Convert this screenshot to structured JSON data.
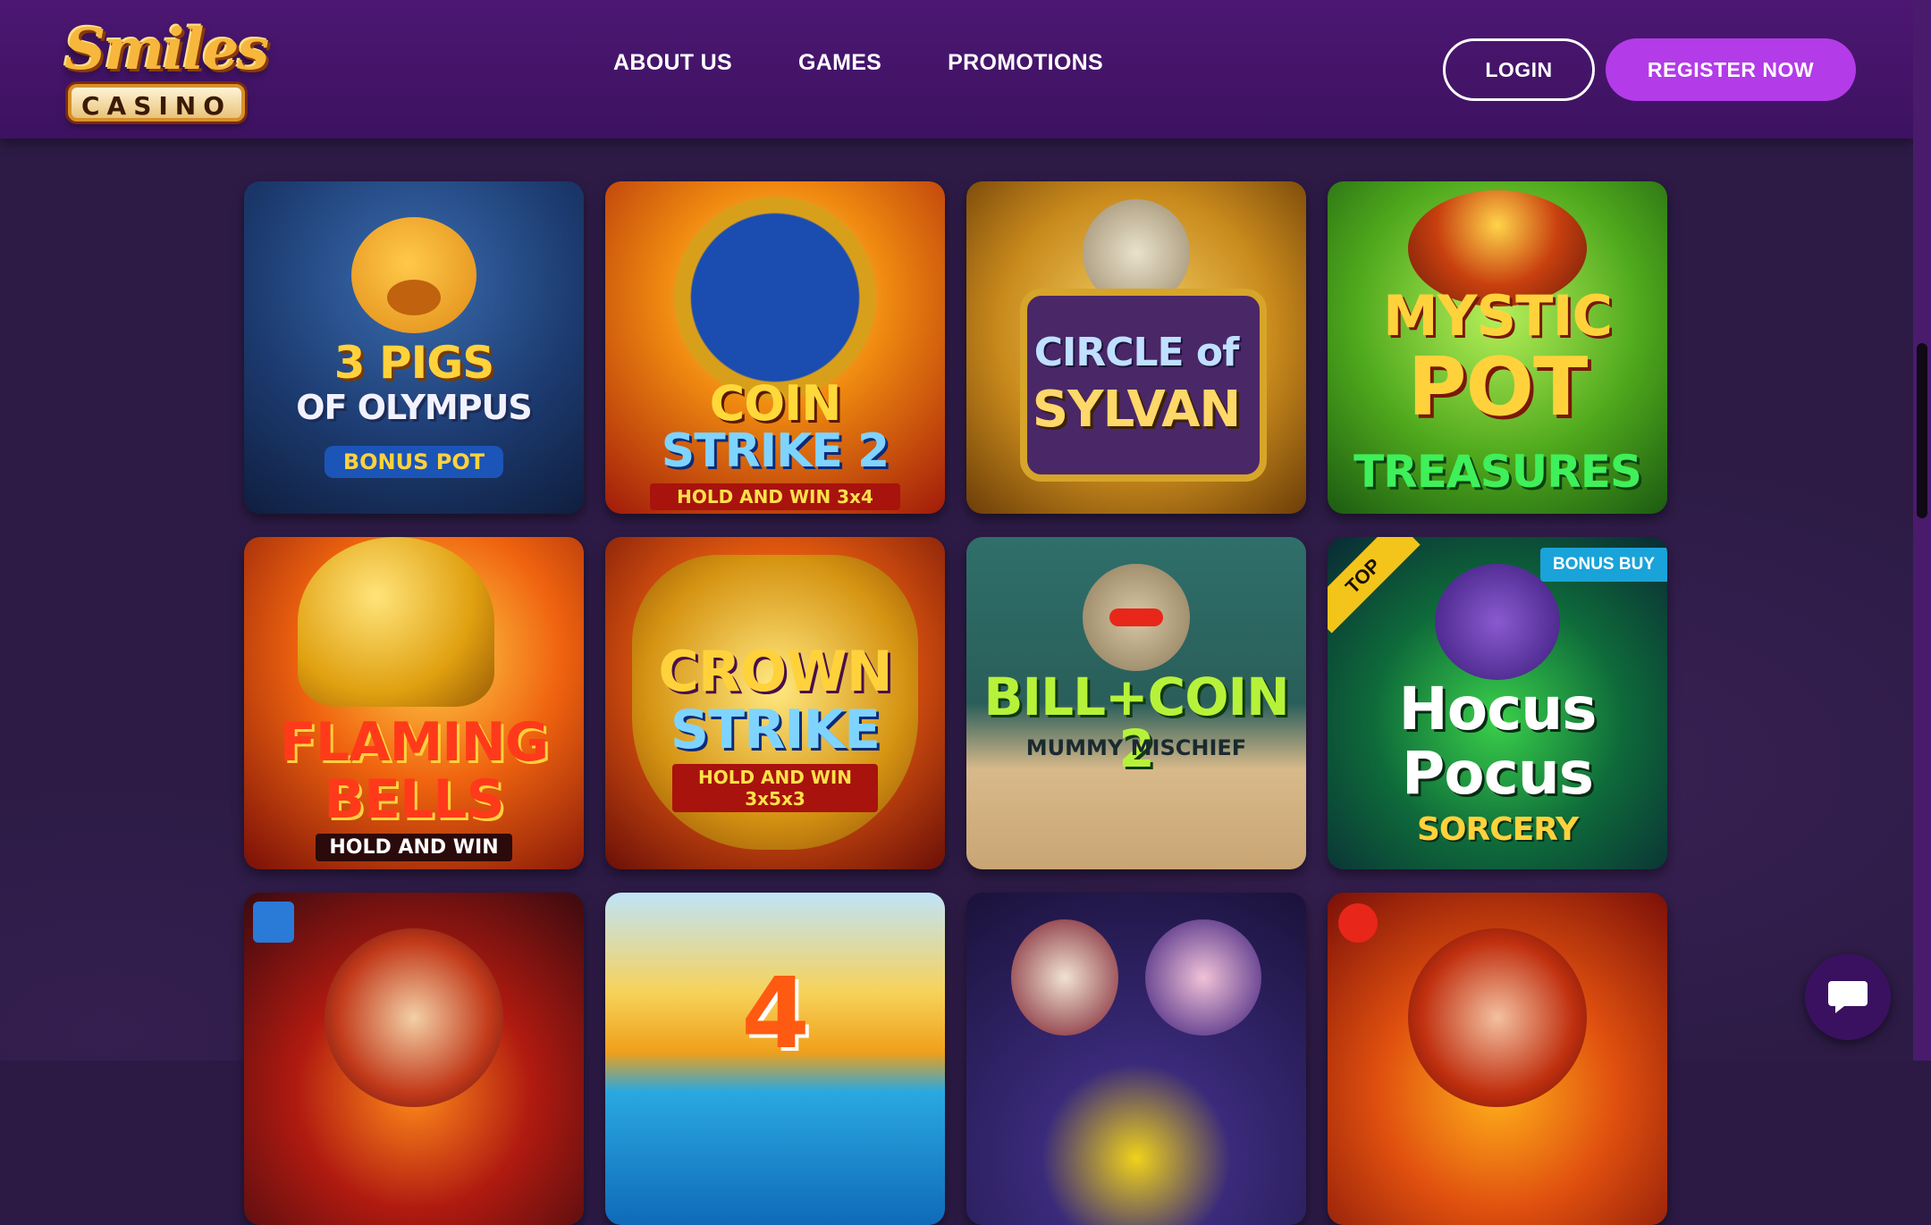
{
  "header": {
    "logo_top": "Smiles",
    "logo_bottom": "CASINO",
    "nav": [
      "ABOUT US",
      "GAMES",
      "PROMOTIONS"
    ],
    "login": "LOGIN",
    "register": "REGISTER NOW"
  },
  "games": [
    {
      "line1": "3 PIGS",
      "line2": "OF OLYMPUS",
      "line3": "BONUS POT"
    },
    {
      "line1": "COIN",
      "line2": "STRIKE 2",
      "line3": "HOLD AND WIN 3x4"
    },
    {
      "line1": "CIRCLE of",
      "line2": "SYLVAN",
      "line3": ""
    },
    {
      "line1": "MYSTIC",
      "line2": "POT",
      "line3": "TREASURES"
    },
    {
      "line1": "FLAMING",
      "line2": "BELLS",
      "line3": "HOLD AND WIN"
    },
    {
      "line1": "CROWN",
      "line2": "STRIKE",
      "line3": "HOLD AND WIN 3x5x3"
    },
    {
      "line1": "BILL+COIN 2",
      "line2": "",
      "line3": "MUMMY MISCHIEF"
    },
    {
      "line1": "Hocus",
      "line2": "Pocus",
      "line3": "SORCERY",
      "badge_top": "TOP",
      "badge_bonus": "BONUS BUY"
    },
    {
      "line1": "",
      "line2": "",
      "line3": ""
    },
    {
      "line1": "4",
      "line2": "",
      "line3": ""
    },
    {
      "line1": "",
      "line2": "",
      "line3": ""
    },
    {
      "line1": "",
      "line2": "",
      "line3": ""
    }
  ]
}
